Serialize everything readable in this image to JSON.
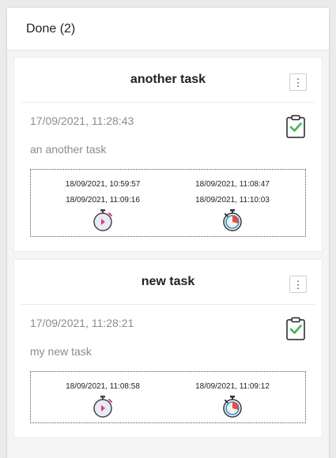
{
  "column": {
    "title": "Done (2)"
  },
  "cards": [
    {
      "title": "another task",
      "menu_icon": "⋮",
      "created": "17/09/2021, 11:28:43",
      "description": "an another task",
      "sessions": [
        {
          "lines": [
            "18/09/2021, 10:59:57",
            "18/09/2021, 11:09:16"
          ],
          "icon": "stopwatch-icon"
        },
        {
          "lines": [
            "18/09/2021, 11:08:47",
            "18/09/2021, 11:10:03"
          ],
          "icon": "timer-icon"
        }
      ]
    },
    {
      "title": "new task",
      "menu_icon": "⋮",
      "created": "17/09/2021, 11:28:21",
      "description": "my new task",
      "sessions": [
        {
          "lines": [
            "18/09/2021, 11:08:58"
          ],
          "icon": "stopwatch-icon"
        },
        {
          "lines": [
            "18/09/2021, 11:09:12"
          ],
          "icon": "timer-icon"
        }
      ]
    }
  ],
  "colors": {
    "check": "#3cb65a",
    "stopwatch_accent": "#e33a8f",
    "timer_accent": "#e84d3d",
    "timer_ring": "#2a8cc7"
  }
}
